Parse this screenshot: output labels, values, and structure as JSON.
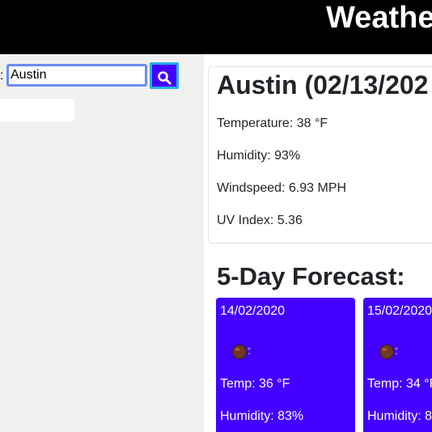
{
  "header": {
    "title": "Weathe"
  },
  "search": {
    "label": ":",
    "value": "Austin",
    "button_icon": "search-icon"
  },
  "current": {
    "title": "Austin (02/13/202",
    "temperature": "Temperature: 38 °F",
    "humidity": "Humidity: 93%",
    "windspeed": "Windspeed: 6.93 MPH",
    "uv_index": "UV Index: 5.36"
  },
  "forecast": {
    "heading": "5-Day Forecast:",
    "days": [
      {
        "date": "14/02/2020",
        "icon": "weather-icon",
        "temp": "Temp: 36 °F",
        "humidity": "Humidity: 83%"
      },
      {
        "date": "15/02/2020",
        "icon": "weather-icon",
        "temp": "Temp: 34 °F",
        "humidity": "Humidity: 8"
      }
    ]
  },
  "colors": {
    "header_bg": "#000000",
    "accent": "#4400ff",
    "button_border": "#27aee8",
    "input_focus": "#6a8cf2",
    "sidebar_bg": "#f0f0f0"
  }
}
